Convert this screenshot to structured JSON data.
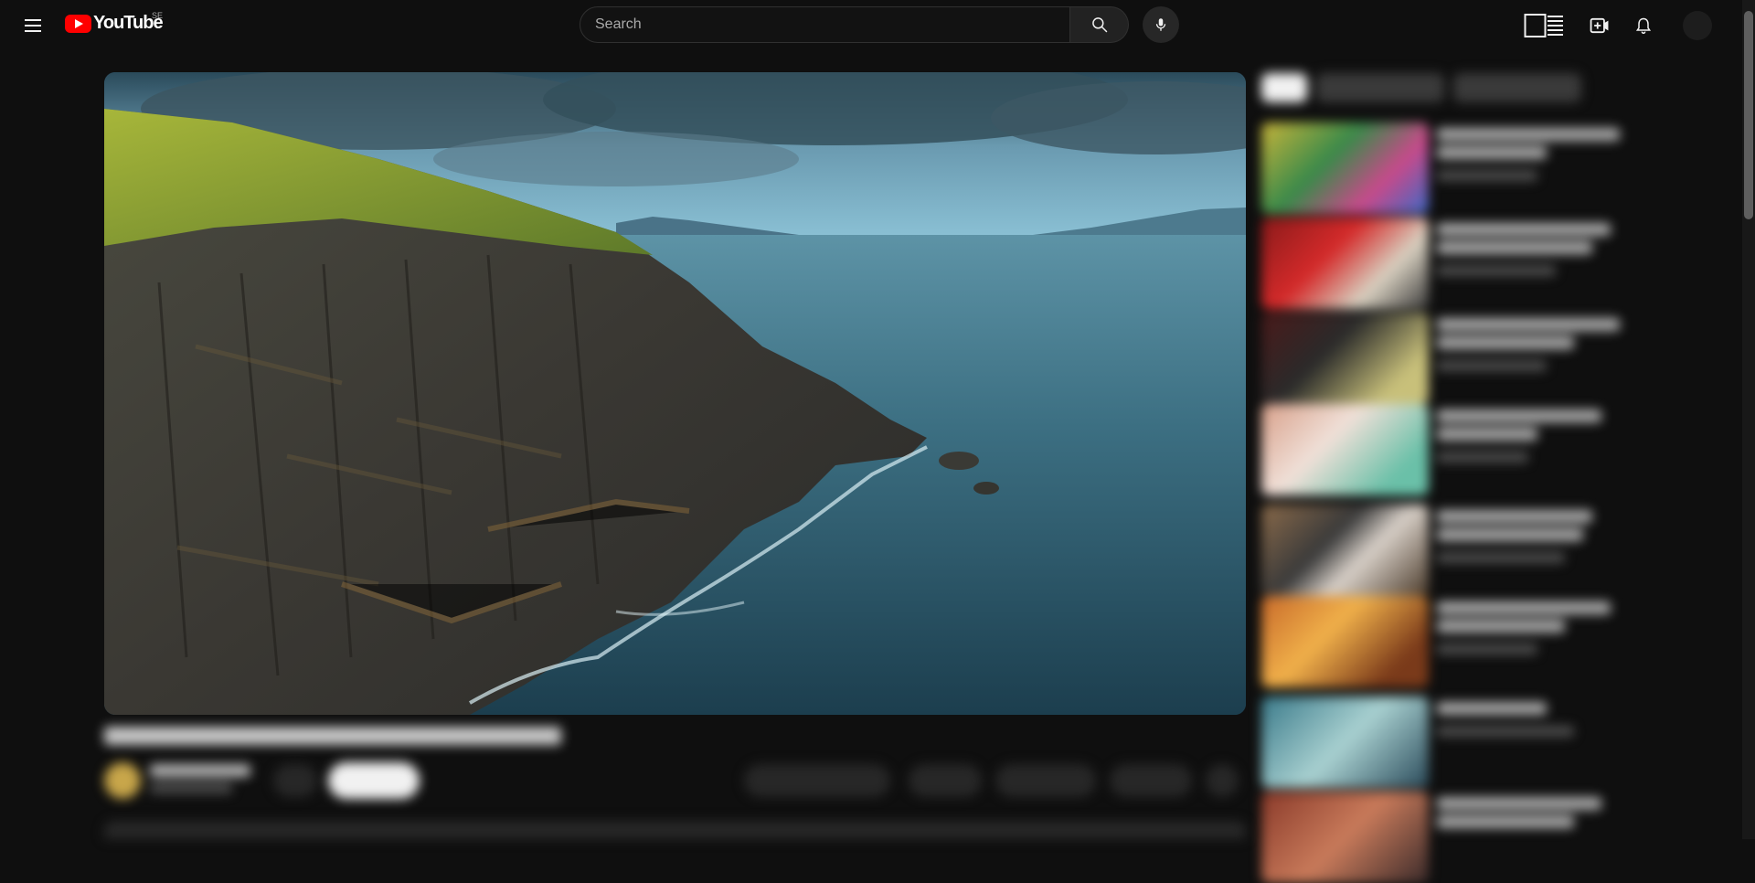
{
  "header": {
    "logo_text": "YouTube",
    "country_code": "SE",
    "search_placeholder": "Search"
  },
  "icons": {
    "menu": "menu-icon",
    "search": "search-icon",
    "mic": "mic-icon",
    "miniplayer": "theater-mode-icon",
    "create": "create-video-icon",
    "notifications": "bell-icon",
    "avatar": "avatar"
  },
  "colors": {
    "background": "#0f0f0f",
    "brand_red": "#ff0000",
    "surface": "#272727"
  }
}
